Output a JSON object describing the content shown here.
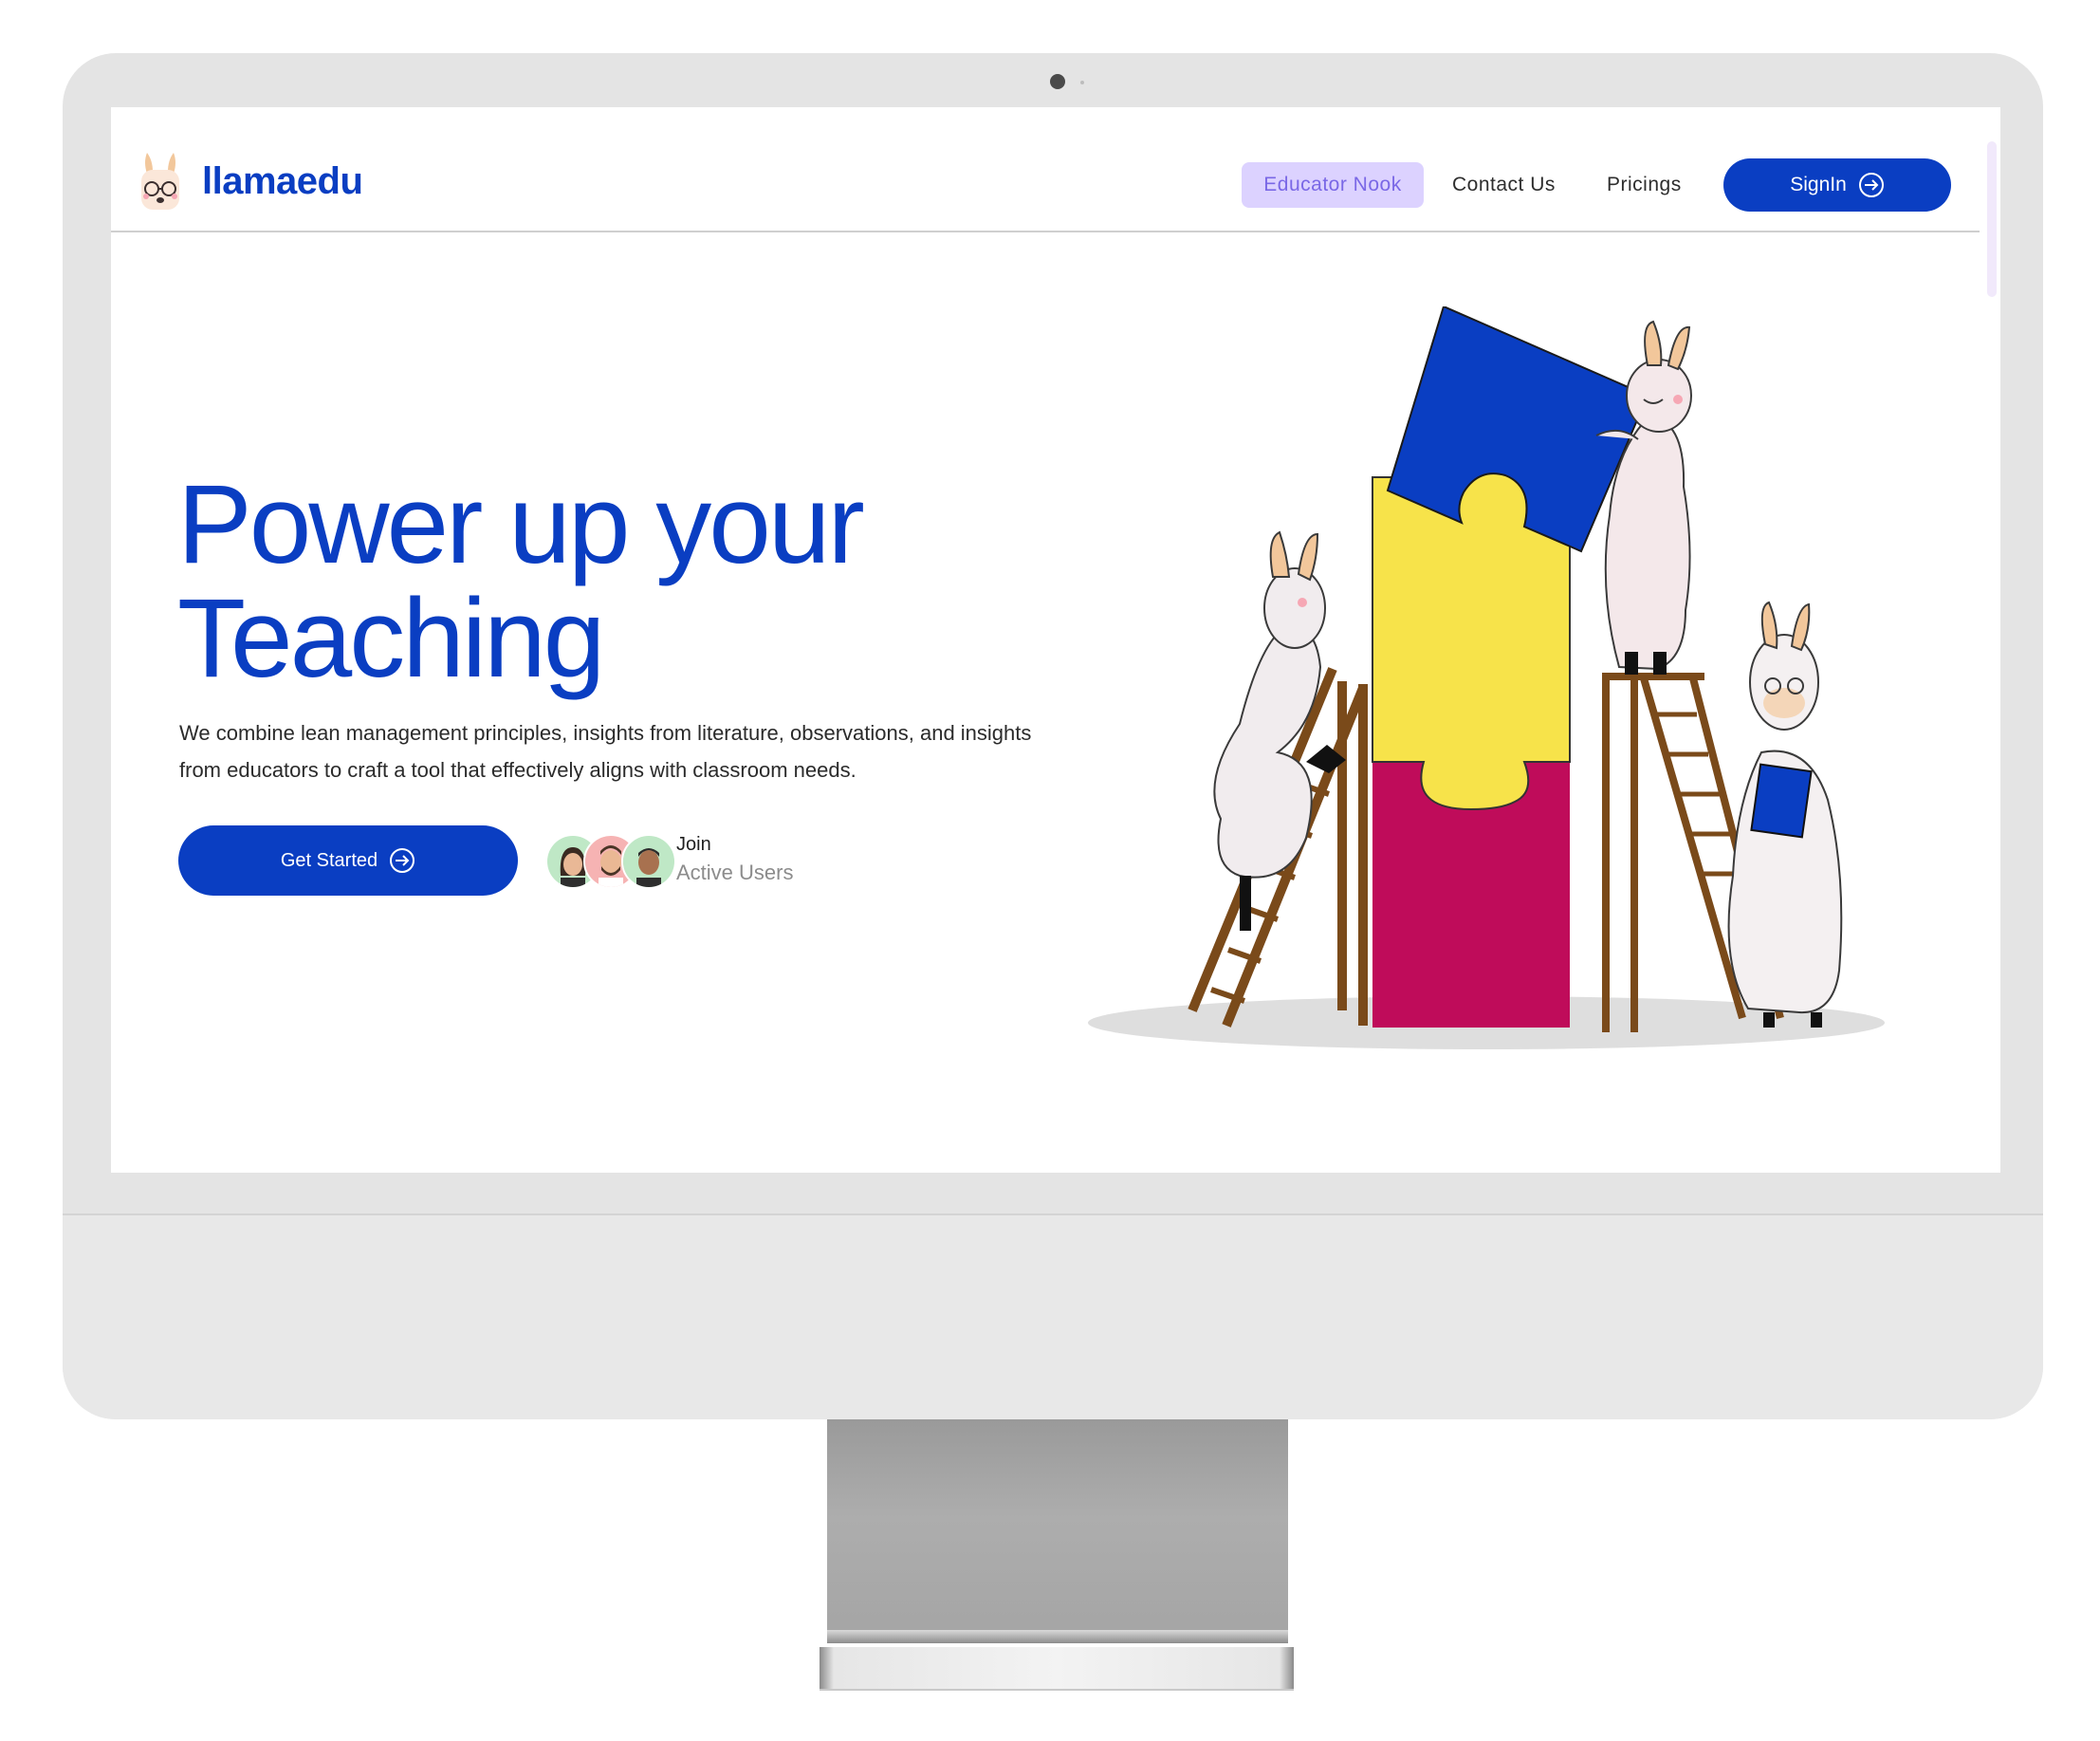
{
  "brand": {
    "name": "llamaedu",
    "accent": "#0a3ec2"
  },
  "nav": {
    "items": [
      {
        "label": "Educator Nook",
        "active": true
      },
      {
        "label": "Contact Us",
        "active": false
      },
      {
        "label": "Pricings",
        "active": false
      }
    ],
    "signin_label": "SignIn"
  },
  "hero": {
    "title_line1": "Power up your",
    "title_line2": "Teaching",
    "description": "We combine lean management principles, insights from literature, observations, and insights from educators to craft a tool that effectively aligns with classroom needs.",
    "cta_label": "Get Started",
    "join_label": "Join",
    "active_users_label": "Active Users"
  },
  "colors": {
    "primary": "#0a3ec2",
    "nav_active_bg": "#dcd2ff",
    "nav_active_text": "#7a68e6",
    "puzzle_blue": "#0a3ec2",
    "puzzle_yellow": "#f7e34a",
    "puzzle_magenta": "#bf0c5a"
  },
  "icons": [
    "llama-logo-icon",
    "arrow-right-circle-icon",
    "avatar-woman",
    "avatar-man-beard",
    "avatar-man"
  ]
}
